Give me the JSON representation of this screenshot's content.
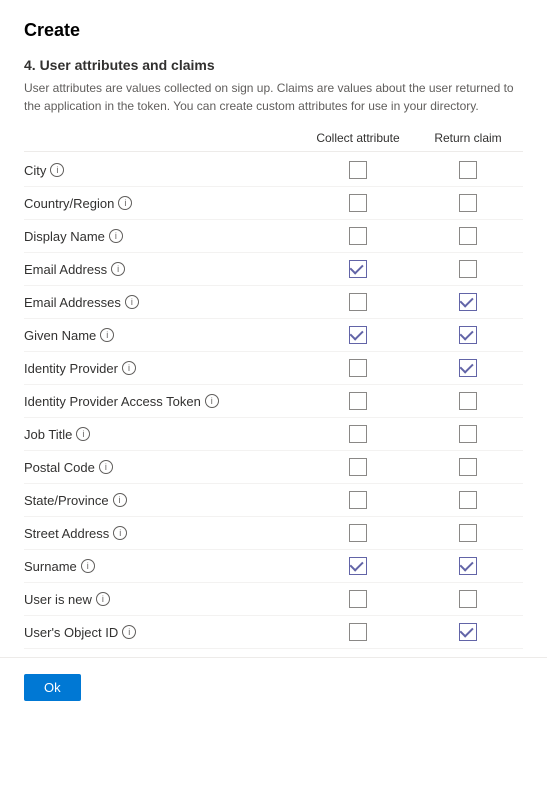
{
  "panel": {
    "title": "Create",
    "section_number": "4. User attributes and claims",
    "section_desc": "User attributes are values collected on sign up. Claims are values about the user returned to the application in the token. You can create custom attributes for use in your directory.",
    "col_collect": "Collect attribute",
    "col_return": "Return claim"
  },
  "attributes": [
    {
      "name": "City",
      "collect": false,
      "return": false
    },
    {
      "name": "Country/Region",
      "collect": false,
      "return": false
    },
    {
      "name": "Display Name",
      "collect": false,
      "return": false
    },
    {
      "name": "Email Address",
      "collect": true,
      "return": false
    },
    {
      "name": "Email Addresses",
      "collect": false,
      "return": true
    },
    {
      "name": "Given Name",
      "collect": true,
      "return": true
    },
    {
      "name": "Identity Provider",
      "collect": false,
      "return": true
    },
    {
      "name": "Identity Provider Access Token",
      "collect": false,
      "return": false
    },
    {
      "name": "Job Title",
      "collect": false,
      "return": false
    },
    {
      "name": "Postal Code",
      "collect": false,
      "return": false
    },
    {
      "name": "State/Province",
      "collect": false,
      "return": false
    },
    {
      "name": "Street Address",
      "collect": false,
      "return": false
    },
    {
      "name": "Surname",
      "collect": true,
      "return": true
    },
    {
      "name": "User is new",
      "collect": false,
      "return": false
    },
    {
      "name": "User's Object ID",
      "collect": false,
      "return": true
    }
  ],
  "footer": {
    "ok_label": "Ok"
  }
}
